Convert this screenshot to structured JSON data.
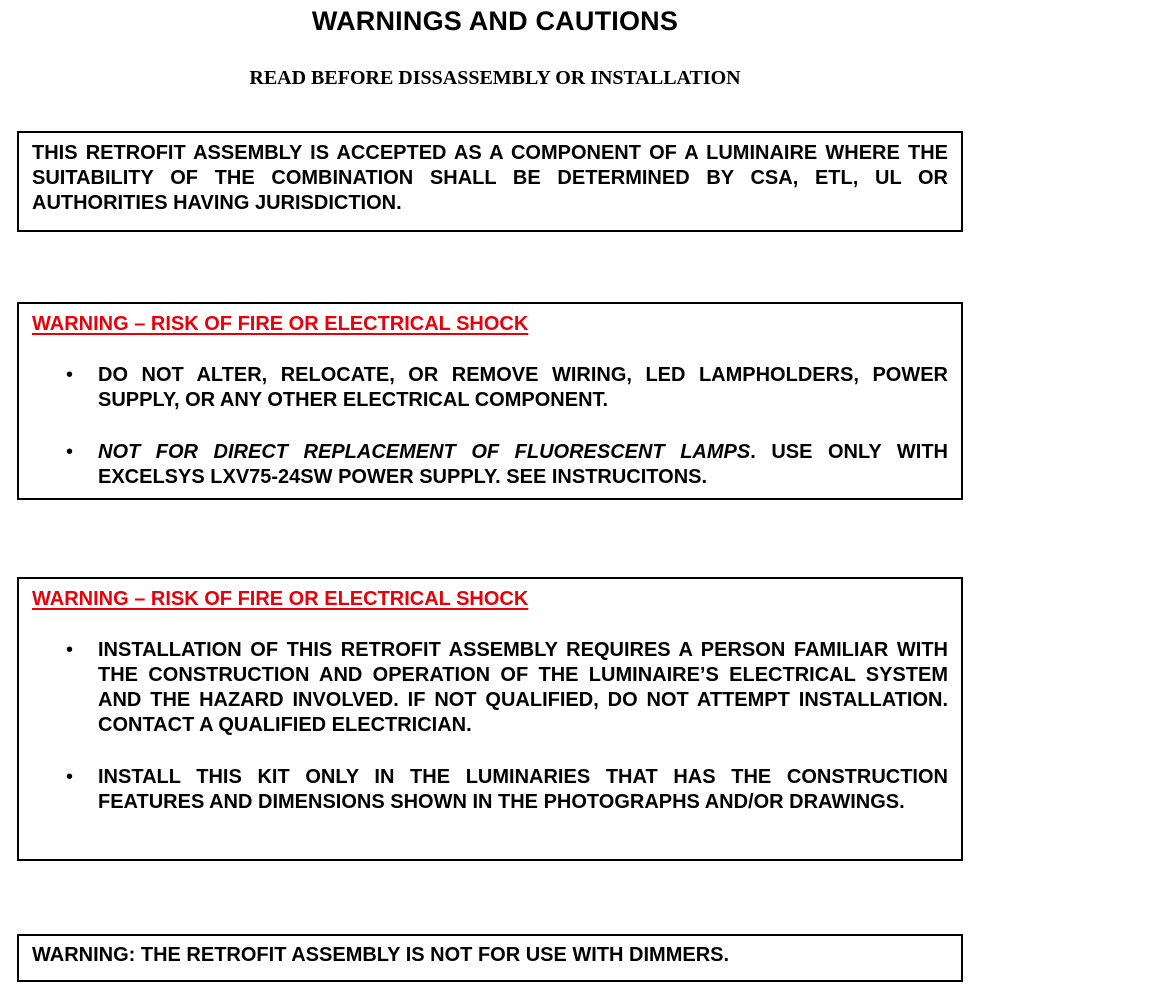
{
  "header": {
    "title": "WARNINGS AND CAUTIONS",
    "subtitle": "READ BEFORE DISSASSEMBLY OR INSTALLATION"
  },
  "notice_box": {
    "text": "THIS RETROFIT ASSEMBLY IS ACCEPTED AS A COMPONENT OF A LUMINAIRE WHERE THE SUITABILITY OF THE COMBINATION SHALL BE DETERMINED BY CSA, ETL, UL OR AUTHORITIES HAVING JURISDICTION."
  },
  "warning_box_1": {
    "heading": "WARNING – RISK OF FIRE OR ELECTRICAL SHOCK",
    "bullets": [
      {
        "text": "DO NOT ALTER, RELOCATE, OR REMOVE WIRING, LED LAMPHOLDERS, POWER SUPPLY, OR ANY OTHER ELECTRICAL COMPONENT."
      },
      {
        "italic_text": "NOT FOR DIRECT REPLACEMENT OF FLUORESCENT LAMPS",
        "text": ".  USE ONLY WITH EXCELSYS LXV75-24SW POWER SUPPLY. SEE INSTRUCITONS."
      }
    ]
  },
  "warning_box_2": {
    "heading": "WARNING – RISK OF FIRE OR ELECTRICAL SHOCK",
    "bullets": [
      {
        "text": "INSTALLATION OF THIS RETROFIT ASSEMBLY REQUIRES A PERSON FAMILIAR WITH THE CONSTRUCTION AND OPERATION OF THE LUMINAIRE’S ELECTRICAL SYSTEM AND THE HAZARD INVOLVED. IF NOT QUALIFIED, DO NOT ATTEMPT INSTALLATION. CONTACT A QUALIFIED ELECTRICIAN."
      },
      {
        "text": "INSTALL THIS KIT ONLY IN THE LUMINARIES THAT HAS THE CONSTRUCTION FEATURES AND DIMENSIONS SHOWN IN THE PHOTOGRAPHS AND/OR DRAWINGS."
      }
    ]
  },
  "dimmer_box": {
    "text": "WARNING:  THE RETROFIT ASSEMBLY IS NOT FOR USE WITH DIMMERS."
  },
  "colors": {
    "warning_red": "#e8000b",
    "text": "#000000",
    "border": "#000000"
  }
}
